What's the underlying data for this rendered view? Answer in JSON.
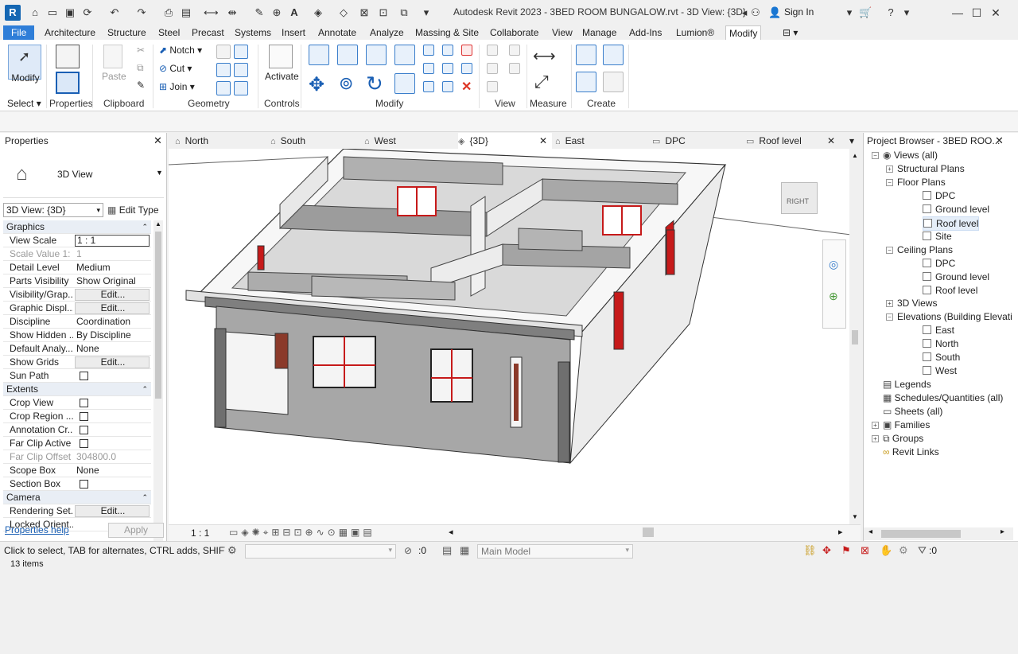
{
  "app": {
    "logo": "R",
    "title": "Autodesk Revit 2023 - 3BED ROOM BUNGALOW.rvt - 3D View: {3D}",
    "sign_in": "Sign In"
  },
  "ribbon_tabs": [
    "File",
    "Architecture",
    "Structure",
    "Steel",
    "Precast",
    "Systems",
    "Insert",
    "Annotate",
    "Analyze",
    "Massing & Site",
    "Collaborate",
    "View",
    "Manage",
    "Add-Ins",
    "Lumion®",
    "Modify"
  ],
  "active_ribbon_tab": "Modify",
  "ribbon": {
    "modify_label": "Modify",
    "select_label": "Select",
    "properties_label": "Properties",
    "paste_label": "Paste",
    "clipboard_label": "Clipboard",
    "notch_label": "Notch",
    "cut_label": "Cut",
    "join_label": "Join",
    "geometry_label": "Geometry",
    "activate_label": "Activate",
    "controls_label": "Controls",
    "modify_panel_label": "Modify",
    "view_label": "View",
    "measure_label": "Measure",
    "create_label": "Create"
  },
  "properties": {
    "title": "Properties",
    "type_name": "3D View",
    "instance_selector": "3D View: {3D}",
    "edit_type": "Edit Type",
    "groups": [
      {
        "name": "Graphics",
        "rows": [
          {
            "name": "View Scale",
            "value": "1 : 1",
            "kind": "boxed"
          },
          {
            "name": "Scale Value    1:",
            "value": "1",
            "kind": "disabled"
          },
          {
            "name": "Detail Level",
            "value": "Medium",
            "kind": "text"
          },
          {
            "name": "Parts Visibility",
            "value": "Show Original",
            "kind": "text"
          },
          {
            "name": "Visibility/Grap...",
            "value": "Edit...",
            "kind": "button"
          },
          {
            "name": "Graphic Displ...",
            "value": "Edit...",
            "kind": "button"
          },
          {
            "name": "Discipline",
            "value": "Coordination",
            "kind": "text"
          },
          {
            "name": "Show Hidden ...",
            "value": "By Discipline",
            "kind": "text"
          },
          {
            "name": "Default Analy...",
            "value": "None",
            "kind": "text"
          },
          {
            "name": "Show Grids",
            "value": "Edit...",
            "kind": "button"
          },
          {
            "name": "Sun Path",
            "value": "",
            "kind": "check"
          }
        ]
      },
      {
        "name": "Extents",
        "rows": [
          {
            "name": "Crop View",
            "value": "",
            "kind": "check"
          },
          {
            "name": "Crop Region ...",
            "value": "",
            "kind": "check"
          },
          {
            "name": "Annotation Cr...",
            "value": "",
            "kind": "check"
          },
          {
            "name": "Far Clip Active",
            "value": "",
            "kind": "check"
          },
          {
            "name": "Far Clip Offset",
            "value": "304800.0",
            "kind": "disabled"
          },
          {
            "name": "Scope Box",
            "value": "None",
            "kind": "text"
          },
          {
            "name": "Section Box",
            "value": "",
            "kind": "check"
          }
        ]
      },
      {
        "name": "Camera",
        "rows": [
          {
            "name": "Rendering Set...",
            "value": "Edit...",
            "kind": "button"
          },
          {
            "name": "Locked Orient...",
            "value": "",
            "kind": "text"
          }
        ]
      }
    ],
    "help_link": "Properties help",
    "apply": "Apply"
  },
  "view_tabs": [
    {
      "label": "North",
      "icon": "⌂"
    },
    {
      "label": "South",
      "icon": "⌂"
    },
    {
      "label": "West",
      "icon": "⌂"
    },
    {
      "label": "{3D}",
      "icon": "◈",
      "active": true
    },
    {
      "label": "East",
      "icon": "⌂"
    },
    {
      "label": "DPC",
      "icon": "▭"
    },
    {
      "label": "Roof level",
      "icon": "▭"
    }
  ],
  "viewcube_label": "RIGHT",
  "view_scale_bottom": "1 : 1",
  "project_browser": {
    "title": "Project Browser - 3BED ROO...",
    "tree": [
      {
        "label": "Views (all)",
        "level": 0,
        "exp": "−",
        "icon": "[o]"
      },
      {
        "label": "Structural Plans",
        "level": 1,
        "exp": "+"
      },
      {
        "label": "Floor Plans",
        "level": 1,
        "exp": "−"
      },
      {
        "label": "DPC",
        "level": 2
      },
      {
        "label": "Ground level",
        "level": 2
      },
      {
        "label": "Roof level",
        "level": 2,
        "selected": true
      },
      {
        "label": "Site",
        "level": 2
      },
      {
        "label": "Ceiling Plans",
        "level": 1,
        "exp": "−"
      },
      {
        "label": "DPC",
        "level": 2
      },
      {
        "label": "Ground level",
        "level": 2
      },
      {
        "label": "Roof level",
        "level": 2
      },
      {
        "label": "3D Views",
        "level": 1,
        "exp": "+"
      },
      {
        "label": "Elevations (Building Elevati",
        "level": 1,
        "exp": "−"
      },
      {
        "label": "East",
        "level": 2
      },
      {
        "label": "North",
        "level": 2
      },
      {
        "label": "South",
        "level": 2
      },
      {
        "label": "West",
        "level": 2
      },
      {
        "label": "Legends",
        "level": 0,
        "icon": "leg"
      },
      {
        "label": "Schedules/Quantities (all)",
        "level": 0,
        "icon": "sch"
      },
      {
        "label": "Sheets (all)",
        "level": 0,
        "icon": "sht"
      },
      {
        "label": "Families",
        "level": 0,
        "exp": "+",
        "icon": "fam"
      },
      {
        "label": "Groups",
        "level": 0,
        "exp": "+",
        "icon": "grp"
      },
      {
        "label": "Revit Links",
        "level": 0,
        "icon": "lnk"
      }
    ]
  },
  "statusbar": {
    "hint": "Click to select, TAB for alternates, CTRL adds, SHIFT unse",
    "count": "13 items",
    "workset_value": ":0",
    "model_label": "Main Model",
    "filter_count": ":0"
  },
  "colors": {
    "file_tab": "#2f7ed8",
    "accent": "#1567b3",
    "window_red": "#c61a1a",
    "selection": "#e5eef9"
  }
}
